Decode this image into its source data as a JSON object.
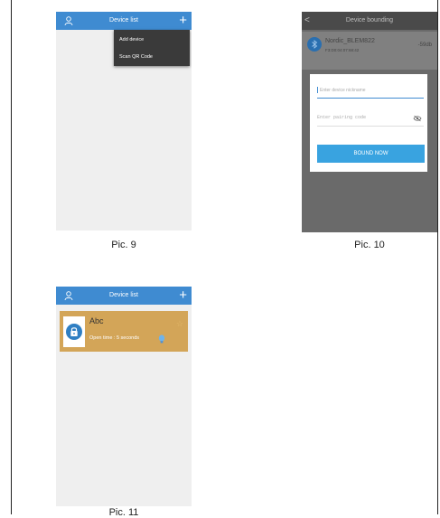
{
  "pic9": {
    "title": "Device list",
    "plus_label": "+",
    "menu": [
      "Add device",
      "Scan QR Code"
    ],
    "caption": "Pic. 9"
  },
  "pic10": {
    "title": "Device bounding",
    "back_label": "<",
    "device": {
      "name": "Nordic_BLEM822",
      "address": "F3:D0:04:07:68:42",
      "rssi": "-59db"
    },
    "nickname_placeholder": "Enter device nickname",
    "pairing_placeholder": "Enter pairing code",
    "button_label": "BOUND NOW",
    "caption": "Pic. 10"
  },
  "pic11": {
    "title": "Device list",
    "plus_label": "+",
    "device_name": "Abc",
    "open_time": "Open time : 5 seconds",
    "caption": "Pic. 11"
  },
  "colors": {
    "topbar": "#3f8bd1",
    "card": "#d3a558",
    "button": "#39a3e0"
  },
  "icons": [
    "user-icon",
    "plus-icon",
    "back-icon",
    "bluetooth-icon",
    "eye-icon",
    "lock-icon",
    "bulb-icon",
    "star-icon"
  ]
}
